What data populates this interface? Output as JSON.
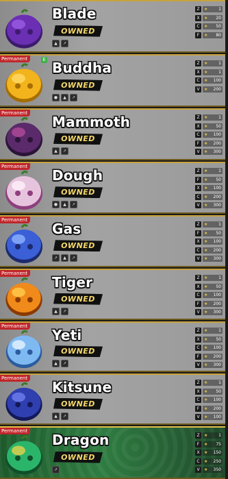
{
  "owned_label": "OWNED",
  "permanent_label": "Permanent",
  "fruits": [
    {
      "name": "Blade",
      "permanent": false,
      "badge": "",
      "moves": [
        {
          "key": "Z",
          "level": "1"
        },
        {
          "key": "X",
          "level": "20"
        },
        {
          "key": "C",
          "level": "50"
        },
        {
          "key": "F",
          "level": "80"
        }
      ],
      "tags": [
        "▲",
        "↗"
      ],
      "icon": "purple-cube-fruit-icon"
    },
    {
      "name": "Buddha",
      "permanent": true,
      "badge": "E",
      "moves": [
        {
          "key": "Z",
          "level": "1"
        },
        {
          "key": "X",
          "level": "1"
        },
        {
          "key": "C",
          "level": "100"
        },
        {
          "key": "V",
          "level": "200"
        }
      ],
      "tags": [
        "●",
        "▲",
        "↗"
      ],
      "icon": "golden-buddha-fruit-icon"
    },
    {
      "name": "Mammoth",
      "permanent": true,
      "badge": "",
      "moves": [
        {
          "key": "Z",
          "level": "1"
        },
        {
          "key": "X",
          "level": "50"
        },
        {
          "key": "C",
          "level": "100"
        },
        {
          "key": "F",
          "level": "200"
        },
        {
          "key": "V",
          "level": "300"
        }
      ],
      "tags": [
        "▲",
        "↗"
      ],
      "icon": "mammoth-fruit-icon"
    },
    {
      "name": "Dough",
      "permanent": true,
      "badge": "",
      "moves": [
        {
          "key": "Z",
          "level": "1"
        },
        {
          "key": "F",
          "level": "50"
        },
        {
          "key": "X",
          "level": "100"
        },
        {
          "key": "C",
          "level": "200"
        },
        {
          "key": "V",
          "level": "300"
        }
      ],
      "tags": [
        "●",
        "▲",
        "↗"
      ],
      "icon": "dough-fruit-icon"
    },
    {
      "name": "Gas",
      "permanent": true,
      "badge": "",
      "moves": [
        {
          "key": "Z",
          "level": "1"
        },
        {
          "key": "F",
          "level": "50"
        },
        {
          "key": "X",
          "level": "100"
        },
        {
          "key": "C",
          "level": "200"
        },
        {
          "key": "V",
          "level": "300"
        }
      ],
      "tags": [
        "↗",
        "▲",
        "↗"
      ],
      "icon": "gas-fruit-icon"
    },
    {
      "name": "Tiger",
      "permanent": true,
      "badge": "",
      "moves": [
        {
          "key": "Z",
          "level": "1"
        },
        {
          "key": "X",
          "level": "50"
        },
        {
          "key": "C",
          "level": "100"
        },
        {
          "key": "F",
          "level": "200"
        },
        {
          "key": "V",
          "level": "300"
        }
      ],
      "tags": [
        "▲",
        "↗"
      ],
      "icon": "tiger-fruit-icon"
    },
    {
      "name": "Yeti",
      "permanent": true,
      "badge": "",
      "moves": [
        {
          "key": "Z",
          "level": "1"
        },
        {
          "key": "X",
          "level": "50"
        },
        {
          "key": "C",
          "level": "100"
        },
        {
          "key": "F",
          "level": "200"
        },
        {
          "key": "V",
          "level": "300"
        }
      ],
      "tags": [
        "▲",
        "↗"
      ],
      "icon": "yeti-fruit-icon"
    },
    {
      "name": "Kitsune",
      "permanent": true,
      "badge": "",
      "moves": [
        {
          "key": "Z",
          "level": "1"
        },
        {
          "key": "X",
          "level": "50"
        },
        {
          "key": "C",
          "level": "100"
        },
        {
          "key": "F",
          "level": "200"
        },
        {
          "key": "V",
          "level": "100"
        }
      ],
      "tags": [
        "▲",
        "↗"
      ],
      "icon": "kitsune-fruit-icon"
    },
    {
      "name": "Dragon",
      "permanent": true,
      "badge": "",
      "moves": [
        {
          "key": "Z",
          "level": "1"
        },
        {
          "key": "F",
          "level": "75"
        },
        {
          "key": "X",
          "level": "150"
        },
        {
          "key": "C",
          "level": "250"
        },
        {
          "key": "V",
          "level": "350"
        }
      ],
      "tags": [
        "↗"
      ],
      "icon": "dragon-fruit-icon"
    }
  ]
}
